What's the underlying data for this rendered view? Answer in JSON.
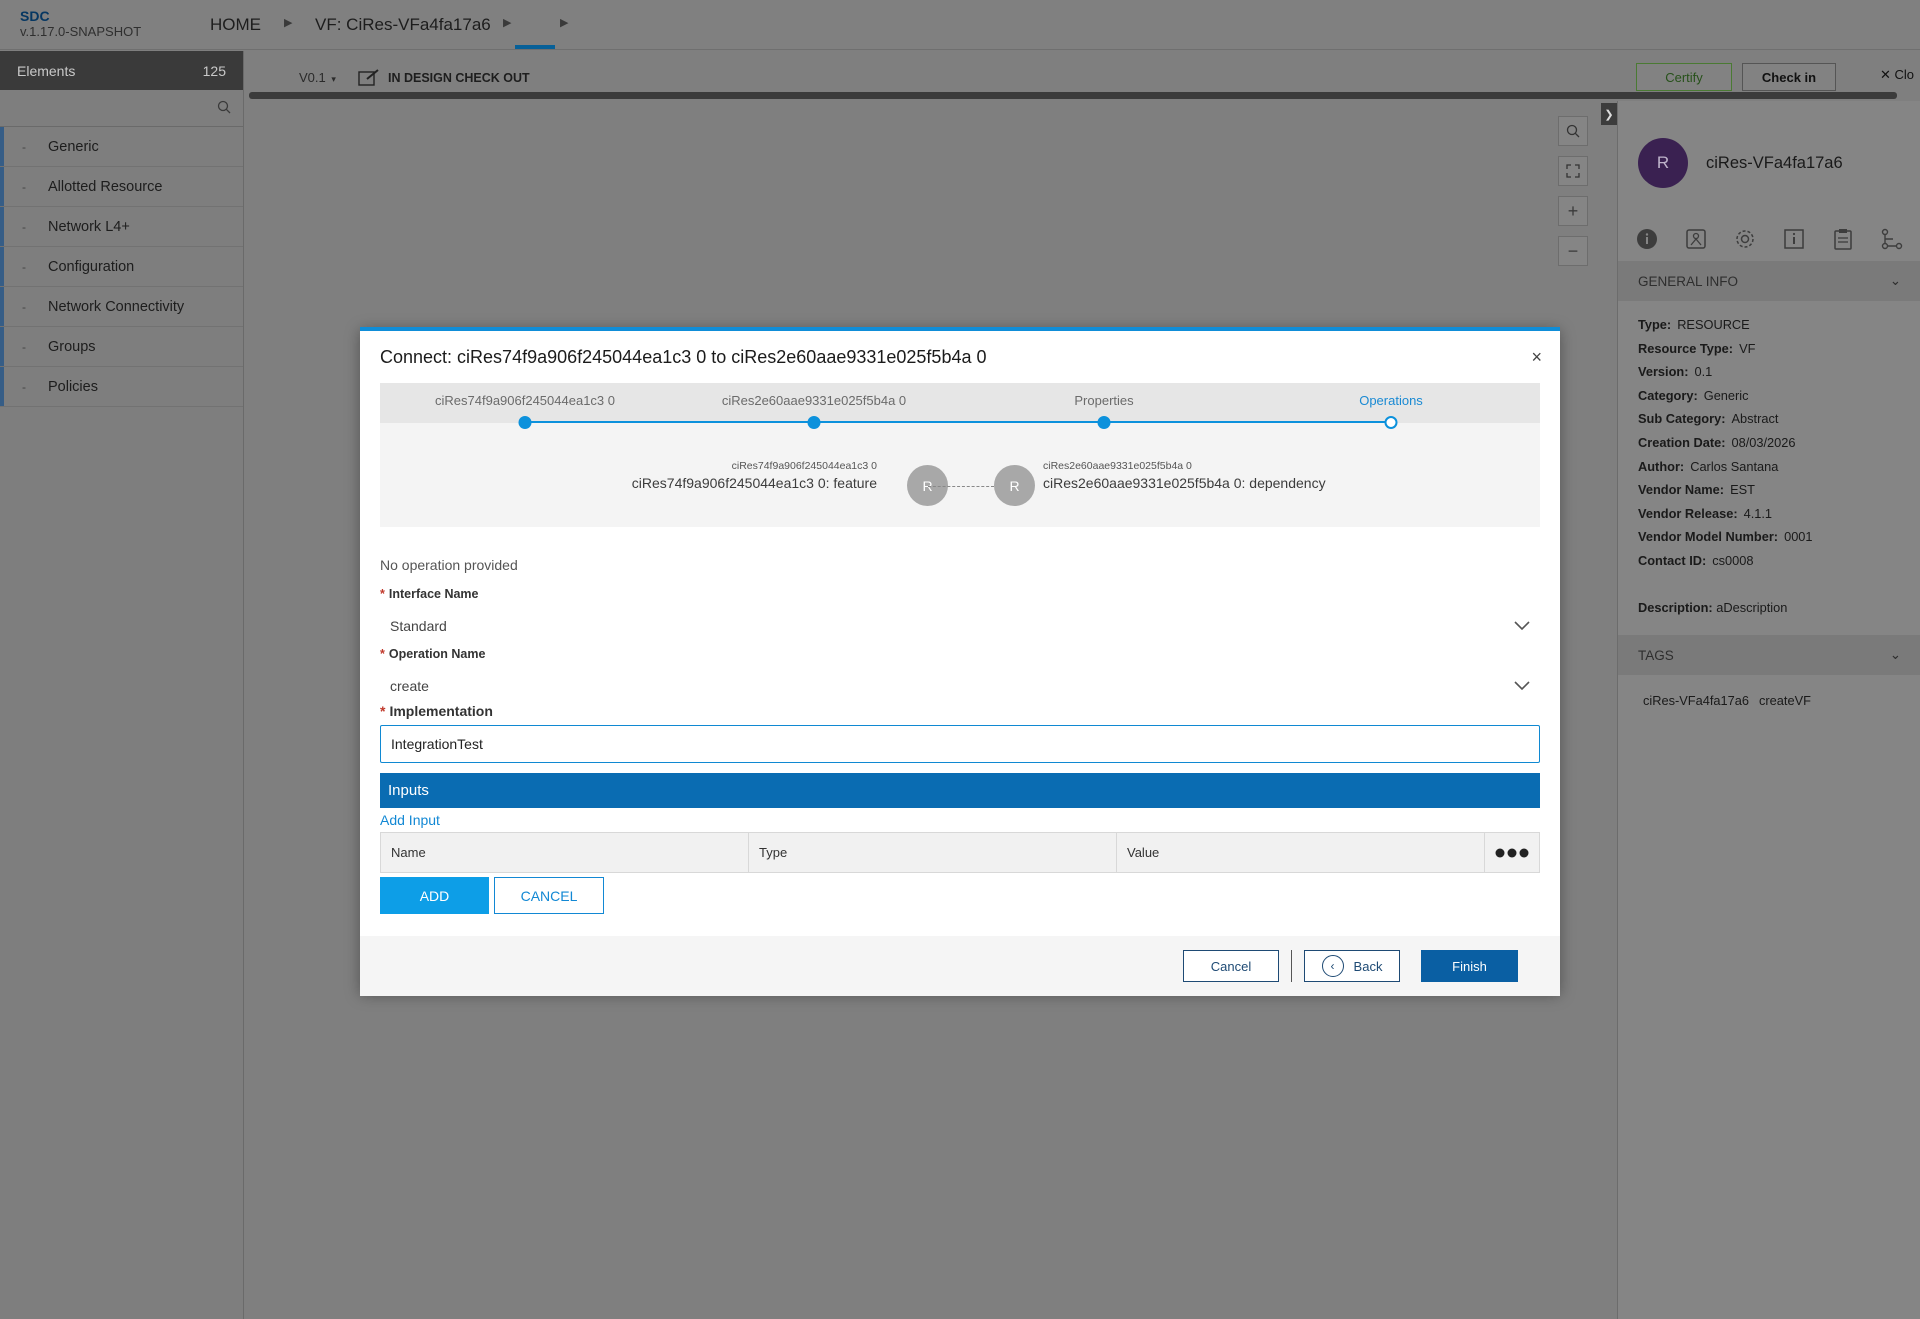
{
  "app": {
    "name": "SDC",
    "version": "v.1.17.0-SNAPSHOT"
  },
  "breadcrumb": {
    "home": "HOME",
    "resource": "VF: CiRes-VFa4fa17a6"
  },
  "left_panel": {
    "title": "Elements",
    "count": "125",
    "search_placeholder": "",
    "categories": [
      "Generic",
      "Allotted Resource",
      "Network L4+",
      "Configuration",
      "Network Connectivity",
      "Groups",
      "Policies"
    ]
  },
  "toolbar": {
    "version": "V0.1",
    "status": "IN DESIGN CHECK OUT",
    "certify": "Certify",
    "checkin": "Check in",
    "close": "Clo"
  },
  "right_panel": {
    "avatar_letter": "R",
    "title": "ciRes-VFa4fa17a6",
    "general_info_title": "GENERAL INFO",
    "info": [
      {
        "label": "Type:",
        "value": "RESOURCE"
      },
      {
        "label": "Resource Type:",
        "value": "VF"
      },
      {
        "label": "Version:",
        "value": "0.1"
      },
      {
        "label": "Category:",
        "value": "Generic"
      },
      {
        "label": "Sub Category:",
        "value": "Abstract"
      },
      {
        "label": "Creation Date:",
        "value": "08/03/2026"
      },
      {
        "label": "Author:",
        "value": "Carlos Santana"
      },
      {
        "label": "Vendor Name:",
        "value": "EST"
      },
      {
        "label": "Vendor Release:",
        "value": "4.1.1"
      },
      {
        "label": "Vendor Model Number:",
        "value": "0001"
      },
      {
        "label": "Contact ID:",
        "value": "cs0008"
      }
    ],
    "description_label": "Description:",
    "description_value": "aDescription",
    "tags_title": "TAGS",
    "tags": [
      "ciRes-VFa4fa17a6",
      "createVF"
    ]
  },
  "modal": {
    "title": "Connect: ciRes74f9a906f245044ea1c3 0 to ciRes2e60aae9331e025f5b4a 0",
    "close": "×",
    "steps": [
      "ciRes74f9a906f245044ea1c3 0",
      "ciRes2e60aae9331e025f5b4a 0",
      "Properties",
      "Operations"
    ],
    "current_step": "Operations",
    "from_small": "ciRes74f9a906f245044ea1c3 0",
    "from_big": "ciRes74f9a906f245044ea1c3 0: feature",
    "to_small": "ciRes2e60aae9331e025f5b4a 0",
    "to_big": "ciRes2e60aae9331e025f5b4a 0: dependency",
    "node_letter": "R",
    "no_operation": "No operation provided",
    "interface_label": "Interface Name",
    "interface_value": "Standard",
    "operation_label": "Operation Name",
    "operation_value": "create",
    "implementation_label": "Implementation",
    "implementation_value": "IntegrationTest",
    "inputs_title": "Inputs",
    "add_input": "Add Input",
    "columns": [
      "Name",
      "Type",
      "Value"
    ],
    "add_button": "ADD",
    "cancel_small": "CANCEL",
    "footer": {
      "cancel": "Cancel",
      "back": "Back",
      "finish": "Finish"
    }
  },
  "colors": {
    "accent": "#0c91dc",
    "header_blue": "#0a6cb2",
    "finish": "#0a5fa3",
    "required": "#c0392b"
  }
}
